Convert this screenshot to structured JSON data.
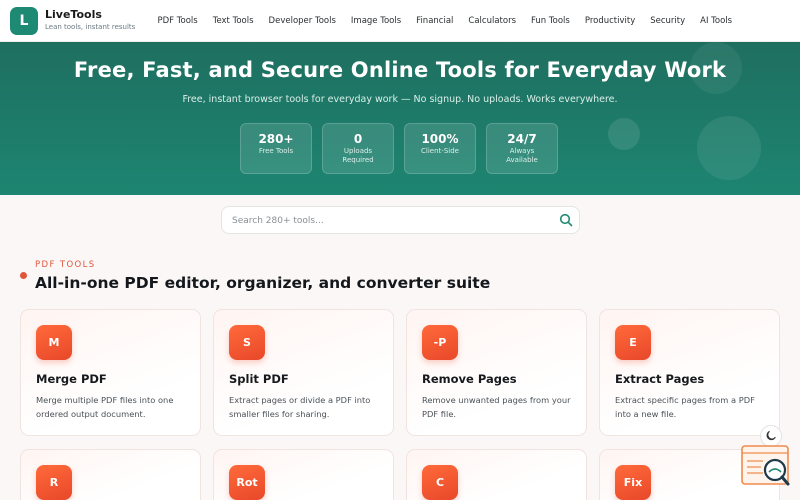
{
  "brand": {
    "logo_letter": "L",
    "name": "LiveTools",
    "tagline": "Lean tools, instant results"
  },
  "nav": [
    "PDF Tools",
    "Text Tools",
    "Developer Tools",
    "Image Tools",
    "Financial",
    "Calculators",
    "Fun Tools",
    "Productivity",
    "Security",
    "AI Tools"
  ],
  "hero": {
    "title": "Free, Fast, and Secure Online Tools for Everyday Work",
    "subtitle": "Free, instant browser tools for everyday work — No signup. No uploads. Works everywhere.",
    "stats": [
      {
        "value": "280+",
        "label": "Free Tools"
      },
      {
        "value": "0",
        "label": "Uploads Required"
      },
      {
        "value": "100%",
        "label": "Client-Side"
      },
      {
        "value": "24/7",
        "label": "Always Available"
      }
    ]
  },
  "search": {
    "placeholder": "Search 280+ tools..."
  },
  "section": {
    "kicker": "PDF TOOLS",
    "title": "All-in-one PDF editor, organizer, and converter suite"
  },
  "cards": [
    {
      "badge": "M",
      "title": "Merge PDF",
      "desc": "Merge multiple PDF files into one ordered output document."
    },
    {
      "badge": "S",
      "title": "Split PDF",
      "desc": "Extract pages or divide a PDF into smaller files for sharing."
    },
    {
      "badge": "-P",
      "title": "Remove Pages",
      "desc": "Remove unwanted pages from your PDF file."
    },
    {
      "badge": "E",
      "title": "Extract Pages",
      "desc": "Extract specific pages from a PDF into a new file."
    },
    {
      "badge": "R",
      "title": "",
      "desc": ""
    },
    {
      "badge": "Rot",
      "title": "",
      "desc": ""
    },
    {
      "badge": "C",
      "title": "",
      "desc": ""
    },
    {
      "badge": "Fix",
      "title": "",
      "desc": ""
    }
  ],
  "colors": {
    "primary": "#1f8a73",
    "accent": "#e0563a",
    "badge": "#f0552f"
  }
}
